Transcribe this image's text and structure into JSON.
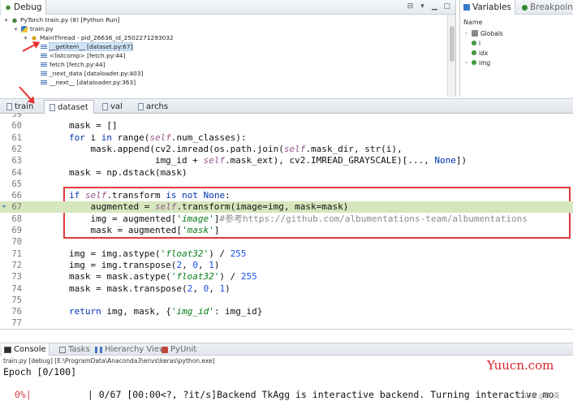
{
  "debug": {
    "tab_label": "Debug",
    "tree": [
      {
        "label": "PyTorch train.py (8) [Python Run]",
        "indent": 0,
        "icon": "bug-icon",
        "twisty": "▾"
      },
      {
        "label": "train.py",
        "indent": 1,
        "icon": "python-file-icon",
        "twisty": "▾"
      },
      {
        "label": "MainThread - pid_26636_id_2502271293032",
        "indent": 2,
        "icon": "thread-icon",
        "twisty": "▾"
      },
      {
        "label": "__getitem__ [dataset.py:67]",
        "indent": 3,
        "icon": "frame-icon",
        "twisty": "",
        "selected": true
      },
      {
        "label": "<listcomp> [fetch.py:44]",
        "indent": 3,
        "icon": "frame-icon",
        "twisty": ""
      },
      {
        "label": "fetch [fetch.py:44]",
        "indent": 3,
        "icon": "frame-icon",
        "twisty": ""
      },
      {
        "label": "_next_data [dataloader.py:403]",
        "indent": 3,
        "icon": "frame-icon",
        "twisty": ""
      },
      {
        "label": "__next__ [dataloader.py:363]",
        "indent": 3,
        "icon": "frame-icon",
        "twisty": ""
      }
    ]
  },
  "variables": {
    "tab_label": "Variables",
    "breakpoints_label": "Breakpoints",
    "column_name": "Name",
    "items": [
      {
        "label": "Globals",
        "icon": "globals-icon",
        "twisty": "›"
      },
      {
        "label": "i",
        "icon": "variable-icon",
        "twisty": ""
      },
      {
        "label": "idx",
        "icon": "variable-icon",
        "twisty": ""
      },
      {
        "label": "img",
        "icon": "variable-icon",
        "twisty": "›"
      }
    ]
  },
  "editor_tabs": [
    {
      "label": "train",
      "active": false
    },
    {
      "label": "dataset",
      "active": true
    },
    {
      "label": "val",
      "active": false
    },
    {
      "label": "archs",
      "active": false
    }
  ],
  "code": [
    {
      "ln": "59",
      "html": ""
    },
    {
      "ln": "60",
      "html": "        mask = []"
    },
    {
      "ln": "61",
      "html": "        <span class=\"kw\">for</span> i <span class=\"kw\">in</span> range(<span class=\"self\">self</span>.num_classes):"
    },
    {
      "ln": "62",
      "html": "            mask.append(cv2.imread(os.path.join(<span class=\"self\">self</span>.mask_dir, str(i),"
    },
    {
      "ln": "63",
      "html": "                        img_id + <span class=\"self\">self</span>.mask_ext), cv2.IMREAD_GRAYSCALE)[..., <span class=\"kw\">None</span>])"
    },
    {
      "ln": "64",
      "html": "        mask = np.dstack(mask)"
    },
    {
      "ln": "65",
      "html": ""
    },
    {
      "ln": "66",
      "html": "        <span class=\"kw\">if</span> <span class=\"self\">self</span>.transform <span class=\"kw\">is not</span> <span class=\"kw\">None</span>:"
    },
    {
      "ln": "67",
      "html": "            augmented = <span class=\"self\">self</span>.transform(image=img, mask=mask)",
      "current": true
    },
    {
      "ln": "68",
      "html": "            img = augmented[<span class=\"str\">'image'</span>]<span class=\"cmt\">#参考https://github.com/albumentations-team/albumentations</span>"
    },
    {
      "ln": "69",
      "html": "            mask = augmented[<span class=\"str\">'mask'</span>]"
    },
    {
      "ln": "70",
      "html": ""
    },
    {
      "ln": "71",
      "html": "        img = img.astype(<span class=\"str\">'float32'</span>) / <span class=\"num\">255</span>"
    },
    {
      "ln": "72",
      "html": "        img = img.transpose(<span class=\"num\">2</span>, <span class=\"num\">0</span>, <span class=\"num\">1</span>)"
    },
    {
      "ln": "73",
      "html": "        mask = mask.astype(<span class=\"str\">'float32'</span>) / <span class=\"num\">255</span>"
    },
    {
      "ln": "74",
      "html": "        mask = mask.transpose(<span class=\"num\">2</span>, <span class=\"num\">0</span>, <span class=\"num\">1</span>)"
    },
    {
      "ln": "75",
      "html": ""
    },
    {
      "ln": "76",
      "html": "        <span class=\"kw\">return</span> img, mask, {<span class=\"str\">'img_id'</span>: img_id}"
    },
    {
      "ln": "77",
      "html": ""
    }
  ],
  "console": {
    "tabs": [
      {
        "label": "Console",
        "icon": "console-icon",
        "active": true
      },
      {
        "label": "Tasks",
        "icon": "tasks-icon",
        "active": false
      },
      {
        "label": "Hierarchy View",
        "icon": "hierarchy-icon",
        "active": false
      },
      {
        "label": "PyUnit",
        "icon": "pyunit-icon",
        "active": false
      }
    ],
    "path": "train.py [debug] [E:\\ProgramData\\Anaconda3\\envs\\keras\\python.exe]",
    "epoch_line": "Epoch [0/100]",
    "progress_prefix": "  0%|",
    "progress_rest": "          | 0/67 [00:00<?, ?it/s]Backend TkAgg is interactive backend. Turning interactive mo"
  },
  "watermark": "Yuucn.com",
  "watermark2": "CSDN @李 青"
}
